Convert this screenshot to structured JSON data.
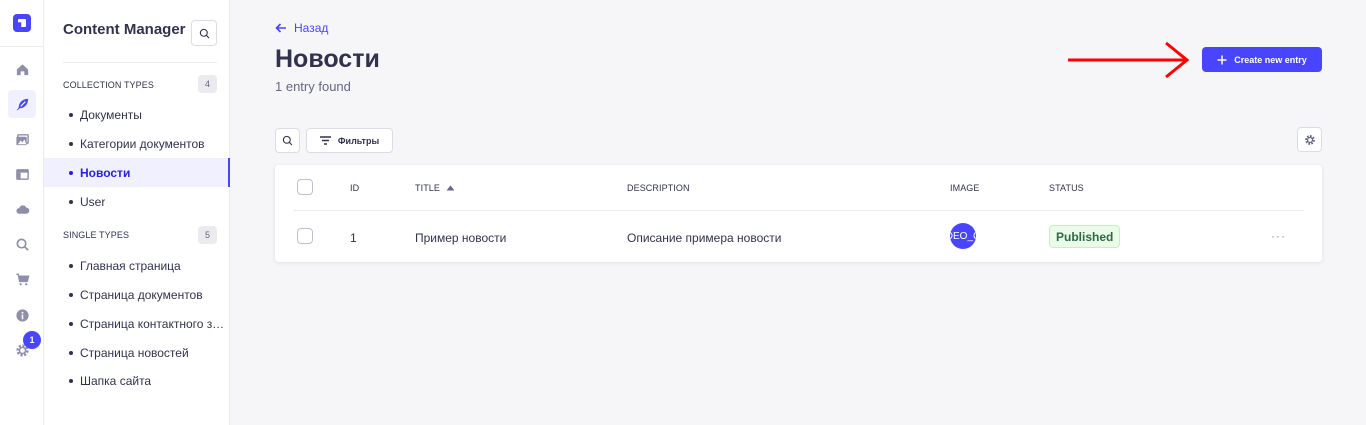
{
  "rail": {
    "icons": [
      "logo-icon",
      "home-icon",
      "feather-icon",
      "media-icon",
      "layout-icon",
      "cloud-icon",
      "search-icon",
      "cart-icon",
      "info-icon",
      "gear-icon"
    ],
    "settings_badge": "1"
  },
  "sidebar": {
    "title": "Content Manager",
    "collection_types": {
      "label": "COLLECTION TYPES",
      "count": "4",
      "items": [
        {
          "label": "Документы",
          "active": false
        },
        {
          "label": "Категории документов",
          "active": false
        },
        {
          "label": "Новости",
          "active": true
        },
        {
          "label": "User",
          "active": false
        }
      ]
    },
    "single_types": {
      "label": "SINGLE TYPES",
      "count": "5",
      "items": [
        {
          "label": "Главная страница"
        },
        {
          "label": "Страница документов"
        },
        {
          "label": "Страница контактного зоо..."
        },
        {
          "label": "Страница новостей"
        },
        {
          "label": "Шапка сайта"
        }
      ]
    }
  },
  "header": {
    "back_label": "Назад",
    "title": "Новости",
    "subtitle": "1 entry found",
    "create_label": "Create new entry"
  },
  "toolbar": {
    "filter_label": "Фильтры"
  },
  "table": {
    "columns": [
      "ID",
      "TITLE",
      "DESCRIPTION",
      "IMAGE",
      "STATUS"
    ],
    "rows": [
      {
        "id": "1",
        "title": "Пример новости",
        "description": "Описание примера новости",
        "image_text": "DEO_C",
        "status": "Published",
        "actions": "···"
      }
    ]
  },
  "colors": {
    "accent": "#4945ff",
    "annotation_arrow": "#ff0000",
    "status_bg": "#eafbe7",
    "status_text": "#2f6846"
  }
}
